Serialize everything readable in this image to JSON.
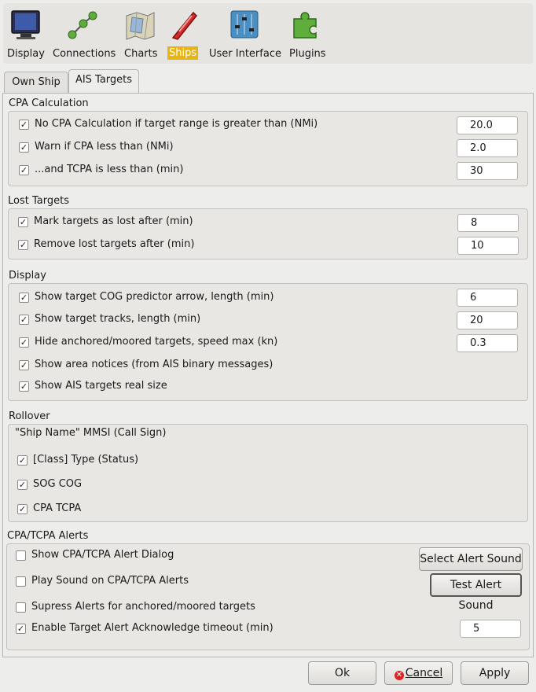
{
  "toolbar": {
    "items": [
      {
        "label": "Display",
        "icon": "monitor-icon"
      },
      {
        "label": "Connections",
        "icon": "network-icon"
      },
      {
        "label": "Charts",
        "icon": "charts-icon"
      },
      {
        "label": "Ships",
        "icon": "ship-icon",
        "selected": true
      },
      {
        "label": "User Interface",
        "icon": "sliders-icon"
      },
      {
        "label": "Plugins",
        "icon": "puzzle-icon"
      }
    ],
    "selected_color": "#e8b414"
  },
  "tabs": [
    {
      "label": "Own Ship"
    },
    {
      "label": "AIS Targets",
      "active": true
    }
  ],
  "cpa": {
    "title": "CPA Calculation",
    "rows": [
      {
        "label": "No CPA Calculation if target range is greater than (NMi)",
        "checked": true,
        "value": "20.0"
      },
      {
        "label": "Warn if CPA less than (NMi)",
        "checked": true,
        "value": "2.0"
      },
      {
        "label": "...and TCPA is less than (min)",
        "checked": true,
        "value": "30"
      }
    ]
  },
  "lost": {
    "title": "Lost Targets",
    "rows": [
      {
        "label": "Mark targets as lost after (min)",
        "checked": true,
        "value": "8"
      },
      {
        "label": "Remove lost targets after (min)",
        "checked": true,
        "value": "10"
      }
    ]
  },
  "display": {
    "title": "Display",
    "rows": [
      {
        "label": "Show target COG predictor arrow, length (min)",
        "checked": true,
        "value": "6"
      },
      {
        "label": "Show target tracks, length (min)",
        "checked": true,
        "value": "20"
      },
      {
        "label": "Hide anchored/moored targets, speed max (kn)",
        "checked": true,
        "value": "0.3"
      },
      {
        "label": "Show area notices (from AIS binary messages)",
        "checked": true
      },
      {
        "label": "Show AIS targets real size",
        "checked": true
      }
    ]
  },
  "rollover": {
    "title": "Rollover",
    "header": "\"Ship Name\" MMSI (Call Sign)",
    "rows": [
      {
        "label": "[Class] Type (Status)",
        "checked": true
      },
      {
        "label": "SOG COG",
        "checked": true
      },
      {
        "label": "CPA TCPA",
        "checked": true
      }
    ]
  },
  "alerts": {
    "title": "CPA/TCPA Alerts",
    "rows": [
      {
        "label": "Show CPA/TCPA Alert Dialog",
        "checked": false
      },
      {
        "label": "Play Sound on CPA/TCPA Alerts",
        "checked": false
      },
      {
        "label": "Supress Alerts for anchored/moored targets",
        "checked": false
      },
      {
        "label": "Enable Target Alert Acknowledge timeout (min)",
        "checked": true,
        "value": "5"
      }
    ],
    "select_sound_label": "Select Alert Sound",
    "test_sound_label": "Test Alert Sound"
  },
  "footer": {
    "ok_label": "Ok",
    "cancel_label": "Cancel",
    "apply_label": "Apply"
  }
}
